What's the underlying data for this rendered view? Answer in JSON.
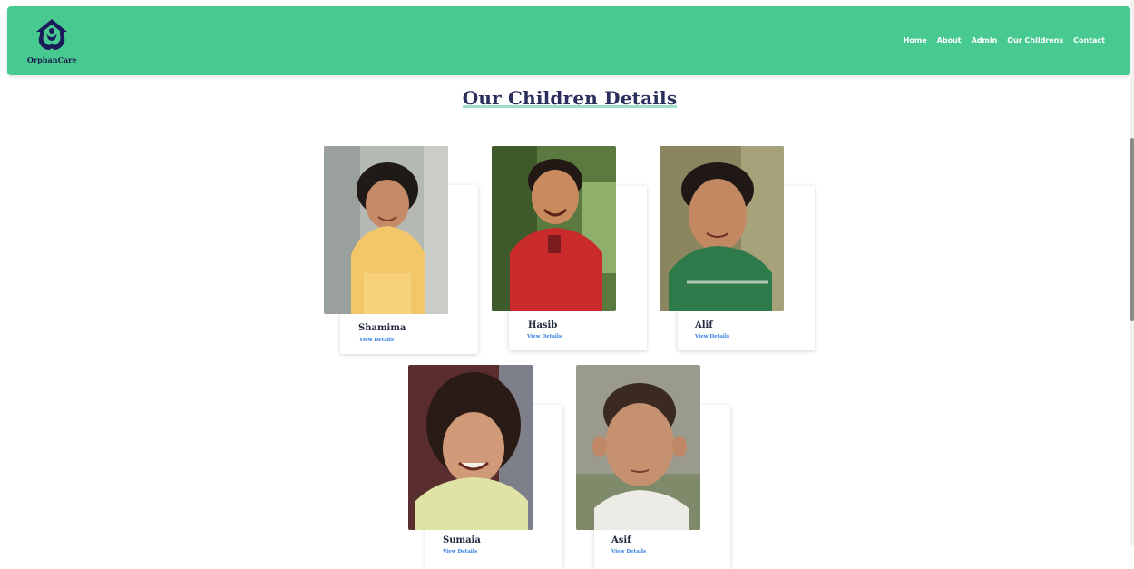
{
  "brand": {
    "name": "OrphanCare"
  },
  "nav": {
    "items": [
      {
        "label": "Home"
      },
      {
        "label": "About"
      },
      {
        "label": "Admin"
      },
      {
        "label": "Our Childrens"
      },
      {
        "label": "Contact"
      }
    ]
  },
  "page": {
    "title": "Our Children Details"
  },
  "children": [
    {
      "name": "Shamima",
      "link": "View Details",
      "photo_icon": "girl-photo"
    },
    {
      "name": "Hasib",
      "link": "View Details",
      "photo_icon": "boy-photo"
    },
    {
      "name": "Alif",
      "link": "View Details",
      "photo_icon": "boy-photo"
    },
    {
      "name": "Sumaia",
      "link": "View Details",
      "photo_icon": "girl-photo"
    },
    {
      "name": "Asif",
      "link": "View Details",
      "photo_icon": "boy-photo"
    }
  ],
  "colors": {
    "accent": "#48c98f",
    "title": "#2a2f5b",
    "link": "#2f7de1"
  }
}
